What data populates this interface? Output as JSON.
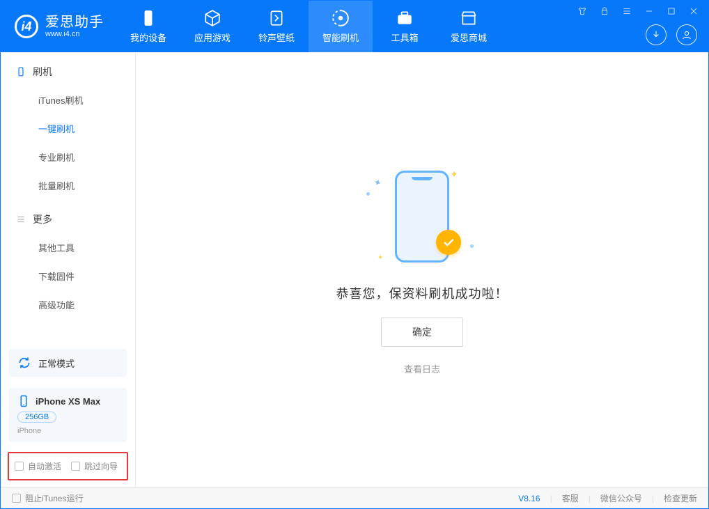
{
  "app": {
    "name_cn": "爱思助手",
    "url": "www.i4.cn"
  },
  "nav": {
    "items": [
      {
        "icon": "phone",
        "label": "我的设备"
      },
      {
        "icon": "cube",
        "label": "应用游戏"
      },
      {
        "icon": "ringtone",
        "label": "铃声壁纸"
      },
      {
        "icon": "flash",
        "label": "智能刷机"
      },
      {
        "icon": "toolbox",
        "label": "工具箱"
      },
      {
        "icon": "store",
        "label": "爱思商城"
      }
    ],
    "active_index": 3
  },
  "sidebar": {
    "group1": {
      "title": "刷机",
      "items": [
        "iTunes刷机",
        "一键刷机",
        "专业刷机",
        "批量刷机"
      ],
      "active_index": 1
    },
    "group2": {
      "title": "更多",
      "items": [
        "其他工具",
        "下载固件",
        "高级功能"
      ]
    }
  },
  "mode_card": {
    "label": "正常模式"
  },
  "device_card": {
    "name": "iPhone XS Max",
    "storage": "256GB",
    "subtitle": "iPhone"
  },
  "options": {
    "auto_activate": "自动激活",
    "skip_guide": "跳过向导"
  },
  "main": {
    "message": "恭喜您，保资料刷机成功啦！",
    "ok_button": "确定",
    "log_link": "查看日志"
  },
  "statusbar": {
    "block_itunes": "阻止iTunes运行",
    "version": "V8.16",
    "support": "客服",
    "wechat": "微信公众号",
    "update": "检查更新"
  }
}
